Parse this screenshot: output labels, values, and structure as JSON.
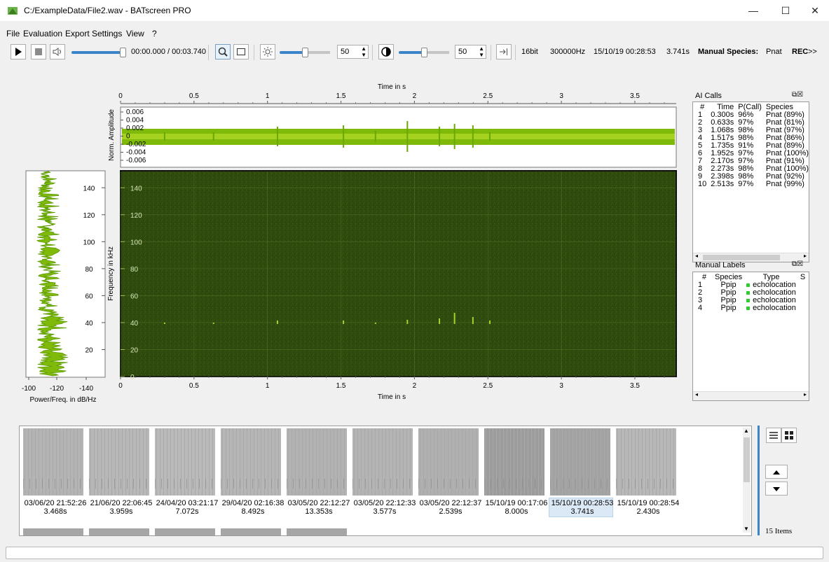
{
  "window": {
    "title": "C:/ExampleData/File2.wav - BATscreen PRO",
    "minimize": "—",
    "maximize": "☐",
    "close": "✕"
  },
  "menu": [
    "File",
    "Evaluation",
    "Export",
    "Settings",
    "View",
    "?"
  ],
  "toolbar": {
    "play_icon": "play-icon",
    "stop_icon": "stop-icon",
    "volume_icon": "speaker-icon",
    "time_display": "00:00.000 / 00:03.740",
    "brightness_value": "50",
    "contrast_value": "50",
    "bit_depth": "16bit",
    "sample_rate": "300000Hz",
    "datetime": "15/10/19 00:28:53",
    "duration": "3.741s",
    "manual_species_label": "Manual Species:",
    "manual_species_value": "Pnat",
    "rec_label": "REC",
    "overflow": ">>",
    "volume_level": 1.0,
    "brightness_level": 0.5,
    "contrast_level": 0.5
  },
  "waveform": {
    "ylabel": "Norm. Amplitude",
    "yticks": [
      "0.006",
      "0.004",
      "0.002",
      "0",
      "-0.002",
      "-0.004",
      "-0.006"
    ],
    "color": "#7fba0b"
  },
  "spectrogram": {
    "ylabel": "Frequency in kHz",
    "yticks": [
      "140",
      "120",
      "100",
      "80",
      "60",
      "40",
      "20",
      "0"
    ],
    "xlabel_top": "Time in s",
    "xlabel_bottom": "Time in s",
    "xticks": [
      "0",
      "0.5",
      "1",
      "1.5",
      "2",
      "2.5",
      "3",
      "3.5"
    ],
    "background": "#2e4a0c"
  },
  "power_spectrum": {
    "xlabel": "Power/Freq. in dB/Hz",
    "xticks": [
      "-100",
      "-120",
      "-140"
    ],
    "yticks": [
      "140",
      "120",
      "100",
      "80",
      "60",
      "40",
      "20"
    ]
  },
  "chart_data": {
    "type": "line",
    "xlabel": "Time in s",
    "ylabel": "Frequency in kHz",
    "xlim": [
      0,
      3.74
    ],
    "ylim": [
      0,
      150
    ],
    "call_times": [
      0.3,
      0.633,
      1.068,
      1.517,
      1.735,
      1.952,
      2.17,
      2.273,
      2.398,
      2.513
    ],
    "call_freq_khz": 40
  },
  "ai_calls": {
    "title": "AI Calls",
    "headers": [
      "#",
      "Time",
      "P(Call)",
      "Species"
    ],
    "rows": [
      [
        "1",
        "0.300s",
        "96%",
        "Pnat (89%)"
      ],
      [
        "2",
        "0.633s",
        "97%",
        "Pnat (81%)"
      ],
      [
        "3",
        "1.068s",
        "98%",
        "Pnat (97%)"
      ],
      [
        "4",
        "1.517s",
        "98%",
        "Pnat (86%)"
      ],
      [
        "5",
        "1.735s",
        "91%",
        "Pnat (89%)"
      ],
      [
        "6",
        "1.952s",
        "97%",
        "Pnat (100%)"
      ],
      [
        "7",
        "2.170s",
        "97%",
        "Pnat (91%)"
      ],
      [
        "8",
        "2.273s",
        "98%",
        "Pnat (100%)"
      ],
      [
        "9",
        "2.398s",
        "98%",
        "Pnat (92%)"
      ],
      [
        "10",
        "2.513s",
        "97%",
        "Pnat (99%)"
      ]
    ]
  },
  "manual_labels": {
    "title": "Manual Labels",
    "headers": [
      "#",
      "Species",
      "Type",
      "S"
    ],
    "rows": [
      [
        "1",
        "Ppip",
        "echolocation"
      ],
      [
        "2",
        "Ppip",
        "echolocation"
      ],
      [
        "3",
        "Ppip",
        "echolocation"
      ],
      [
        "4",
        "Ppip",
        "echolocation"
      ]
    ],
    "type_color": "#2ecc2e"
  },
  "thumbnails": [
    {
      "date": "03/06/20 21:52:26",
      "dur": "3.468s"
    },
    {
      "date": "21/06/20 22:06:45",
      "dur": "3.959s"
    },
    {
      "date": "24/04/20 03:21:17",
      "dur": "7.072s"
    },
    {
      "date": "29/04/20 02:16:38",
      "dur": "8.492s"
    },
    {
      "date": "03/05/20 22:12:27",
      "dur": "13.353s"
    },
    {
      "date": "03/05/20 22:12:33",
      "dur": "3.577s"
    },
    {
      "date": "03/05/20 22:12:37",
      "dur": "2.539s"
    },
    {
      "date": "15/10/19 00:17:06",
      "dur": "8.000s"
    },
    {
      "date": "15/10/19 00:28:53",
      "dur": "3.741s"
    },
    {
      "date": "15/10/19 00:28:54",
      "dur": "2.430s"
    }
  ],
  "item_count": "15 Items",
  "selected_thumbnail": 8
}
